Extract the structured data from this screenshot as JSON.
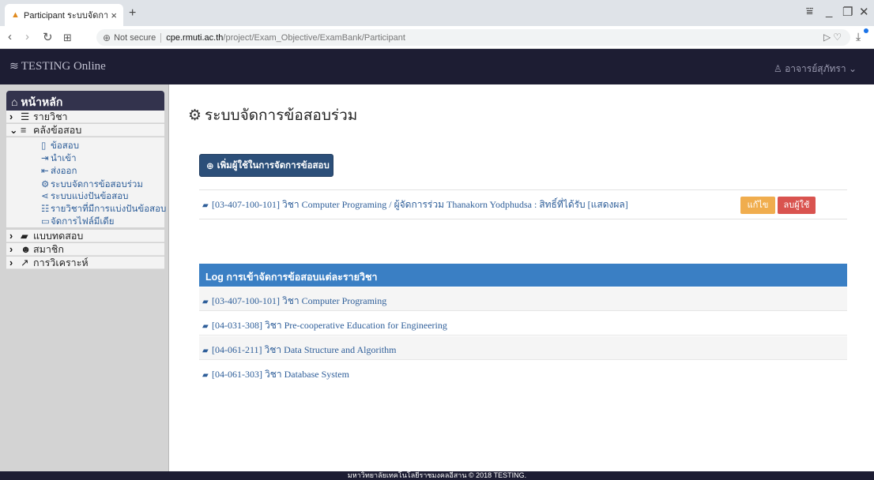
{
  "browser": {
    "tab_title": "Participant ระบบจัดการข้อสอบร่วม",
    "tab_close": "×",
    "new_tab": "+",
    "security": "Not secure",
    "url_host": "cpe.rmuti.ac.th",
    "url_path": "/project/Exam_Objective/ExamBank/Participant",
    "controls": {
      "minimize": "_",
      "restore": "❐",
      "close": "✕",
      "tabsearch": "⩸"
    }
  },
  "navbar": {
    "brand": "TESTING Online",
    "user": "อาจารย์สุภัทรา"
  },
  "sidebar": {
    "home": "หน้าหลัก",
    "menus": [
      {
        "label": "รายวิชา"
      },
      {
        "label": "คลังข้อสอบ"
      },
      {
        "label": "แบบทดสอบ"
      },
      {
        "label": "สมาชิก"
      },
      {
        "label": "การวิเคราะห์"
      }
    ],
    "submenu": [
      {
        "label": "ข้อสอบ"
      },
      {
        "label": "นำเข้า"
      },
      {
        "label": "ส่งออก"
      },
      {
        "label": "ระบบจัดการข้อสอบร่วม"
      },
      {
        "label": "ระบบแบ่งปันข้อสอบ"
      },
      {
        "label": "รายวิชาที่มีการแบ่งปันข้อสอบ"
      },
      {
        "label": "จัดการไฟล์มีเดีย"
      }
    ]
  },
  "main": {
    "title": "ระบบจัดการข้อสอบร่วม",
    "add_button": "เพิ่มผู้ใช้ในการจัดการข้อสอบ",
    "participant_row": "[03-407-100-101] วิชา Computer Programing / ผู้จัดการร่วม Thanakorn Yodphudsa : สิทธิ์ที่ได้รับ [แสดงผล]",
    "edit_button": "แก้ไข",
    "delete_button": "ลบผู้ใช้",
    "log_header": "Log การเข้าจัดการข้อสอบแต่ละรายวิชา",
    "log_items": [
      "[03-407-100-101] วิชา Computer Programing",
      "[04-031-308] วิชา Pre-cooperative Education for Engineering",
      "[04-061-211] วิชา Data Structure and Algorithm",
      "[04-061-303] วิชา Database System"
    ]
  },
  "footer": "มหาวิทยาลัยเทคโนโลยีราชมงคลอีสาน © 2018 TESTING."
}
